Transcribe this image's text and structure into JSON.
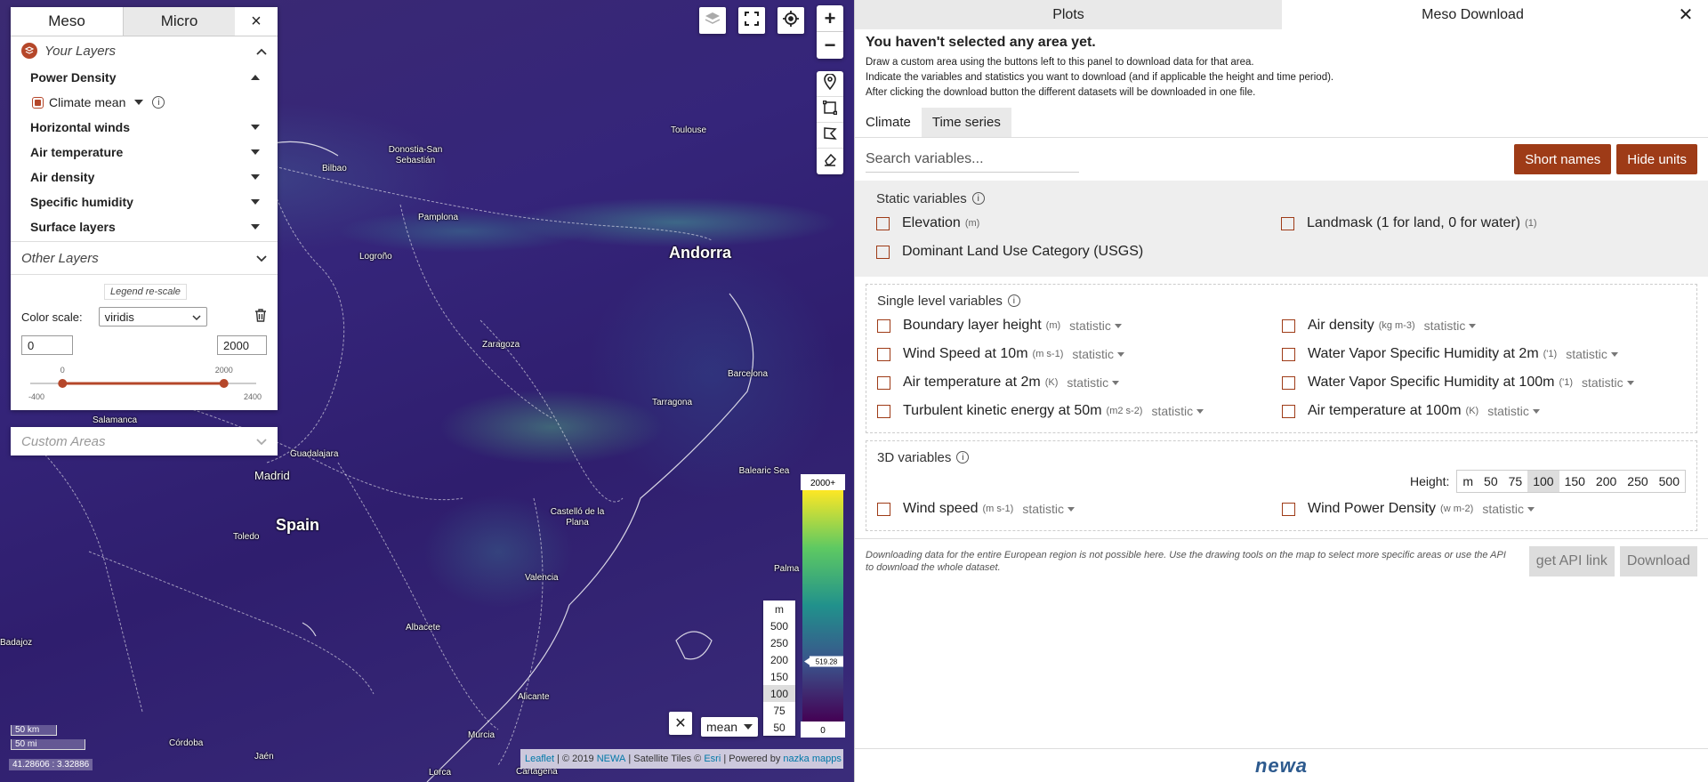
{
  "map": {
    "cities": [
      {
        "name": "Andorra",
        "size": "big"
      },
      {
        "name": "Spain",
        "size": "big"
      },
      {
        "name": "Madrid",
        "size": "mid"
      },
      {
        "name": "Toulouse"
      },
      {
        "name": "Donostia-San Sebastián"
      },
      {
        "name": "Bilbao"
      },
      {
        "name": "Pamplona"
      },
      {
        "name": "Logroño"
      },
      {
        "name": "Zaragoza"
      },
      {
        "name": "Barcelona"
      },
      {
        "name": "Tarragona"
      },
      {
        "name": "Guadalajara"
      },
      {
        "name": "Balearic Sea"
      },
      {
        "name": "Castelló de la Plana"
      },
      {
        "name": "Toledo"
      },
      {
        "name": "Valencia"
      },
      {
        "name": "Albacete"
      },
      {
        "name": "Palma"
      },
      {
        "name": "Alicante"
      },
      {
        "name": "Murcia"
      },
      {
        "name": "Córdoba"
      },
      {
        "name": "Jaén"
      },
      {
        "name": "Lorca"
      },
      {
        "name": "Salamanca"
      },
      {
        "name": "Cartagena"
      },
      {
        "name": "Badajoz"
      }
    ],
    "legend": {
      "top": "2000+",
      "marker": "519.28",
      "bottom": "0",
      "colors": [
        "#fde725",
        "#5ec962",
        "#21918c",
        "#3b528b",
        "#440154"
      ]
    },
    "height_picker": {
      "unit": "m",
      "options": [
        "500",
        "250",
        "200",
        "150",
        "100",
        "75",
        "50"
      ],
      "selected": "100"
    },
    "stat_select": "mean",
    "scale": {
      "km": "50 km",
      "mi": "50 mi"
    },
    "coords": "41.28606 : 3.32886",
    "attribution": {
      "leaflet": "Leaflet",
      "copyright": "| © 2019",
      "newa": "NEWA",
      "tiles": "| Satellite Tiles ©",
      "esri": "Esri",
      "powered": "| Powered by",
      "nazka": "nazka mapps"
    }
  },
  "layer_panel": {
    "tabs": [
      "Meso",
      "Micro"
    ],
    "your_layers": "Your Layers",
    "items": [
      "Power Density",
      "Horizontal winds",
      "Air temperature",
      "Air density",
      "Specific humidity",
      "Surface layers"
    ],
    "sub_item": "Climate mean",
    "other_layers": "Other Layers",
    "legend_rescale": "Legend re-scale",
    "color_scale_label": "Color scale:",
    "color_scale_value": "viridis",
    "min_value": "0",
    "max_value": "2000",
    "slider": {
      "min": -400,
      "max": 2400,
      "low": 0,
      "high": 2000,
      "low_label": "0",
      "high_label": "2000",
      "min_label": "-400",
      "max_label": "2400"
    },
    "custom_areas": "Custom Areas"
  },
  "side": {
    "tabs": {
      "plots": "Plots",
      "download": "Meso Download"
    },
    "title": "You haven't selected any area yet.",
    "lines": [
      "Draw a custom area using the buttons left to this panel to download data for that area.",
      "Indicate the variables and statistics you want to download (and if applicable the height and time period).",
      "After clicking the download button the different datasets will be downloaded in one file."
    ],
    "subtabs": [
      "Climate",
      "Time series"
    ],
    "search_placeholder": "Search variables...",
    "short_names": "Short names",
    "hide_units": "Hide units",
    "statistic": "statistic",
    "static_title": "Static variables",
    "static_vars": [
      {
        "name": "Elevation",
        "unit": "(m)"
      },
      {
        "name": "Landmask (1 for land, 0 for water)",
        "unit": "(1)"
      },
      {
        "name": "Dominant Land Use Category (USGS)",
        "unit": ""
      }
    ],
    "single_title": "Single level variables",
    "single_vars": [
      {
        "name": "Boundary layer height",
        "unit": "(m)"
      },
      {
        "name": "Air density",
        "unit": "(kg m-3)"
      },
      {
        "name": "Wind Speed at 10m",
        "unit": "(m s-1)"
      },
      {
        "name": "Water Vapor Specific Humidity at 2m",
        "unit": "('1)"
      },
      {
        "name": "Air temperature at 2m",
        "unit": "(K)"
      },
      {
        "name": "Water Vapor Specific Humidity at 100m",
        "unit": "('1)"
      },
      {
        "name": "Turbulent kinetic energy at 50m",
        "unit": "(m2 s-2)"
      },
      {
        "name": "Air temperature at 100m",
        "unit": "(K)"
      }
    ],
    "three_d_title": "3D variables",
    "height_label": "Height:",
    "heights": [
      "m",
      "50",
      "75",
      "100",
      "150",
      "200",
      "250",
      "500"
    ],
    "height_selected": "100",
    "three_d_vars": [
      {
        "name": "Wind speed",
        "unit": "(m s-1)"
      },
      {
        "name": "Wind Power Density",
        "unit": "(w m-2)"
      }
    ],
    "note": "Downloading data for the entire European region is not possible here. Use the drawing tools on the map to select more specific areas or use the API to download the whole dataset.",
    "api_button": "get API link",
    "download_button": "Download",
    "logo": "newa"
  }
}
